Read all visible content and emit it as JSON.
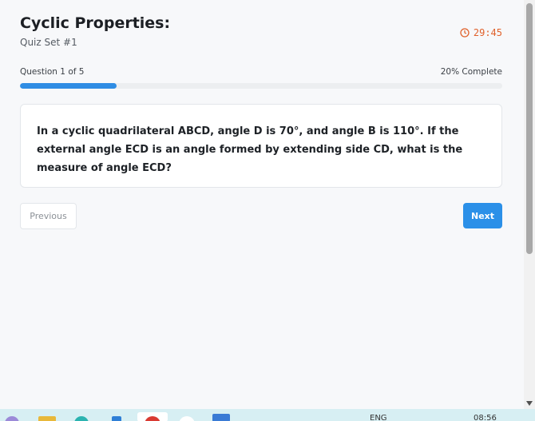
{
  "quiz": {
    "title": "Cyclic Properties:",
    "subtitle": "Quiz Set #1",
    "timer": "29:45"
  },
  "progress": {
    "label": "Question 1 of 5",
    "percent_label": "20% Complete",
    "fraction": 0.2
  },
  "question": {
    "text": "In a cyclic quadrilateral ABCD, angle D is 70°, and angle B is 110°. If the external angle ECD is an angle formed by extending side CD, what is the measure of angle ECD?"
  },
  "nav": {
    "previous_label": "Previous",
    "next_label": "Next"
  },
  "taskbar": {
    "language": "ENG",
    "clock": "08:56"
  },
  "colors": {
    "accent": "#2b90e8",
    "timer": "#e0612b"
  }
}
